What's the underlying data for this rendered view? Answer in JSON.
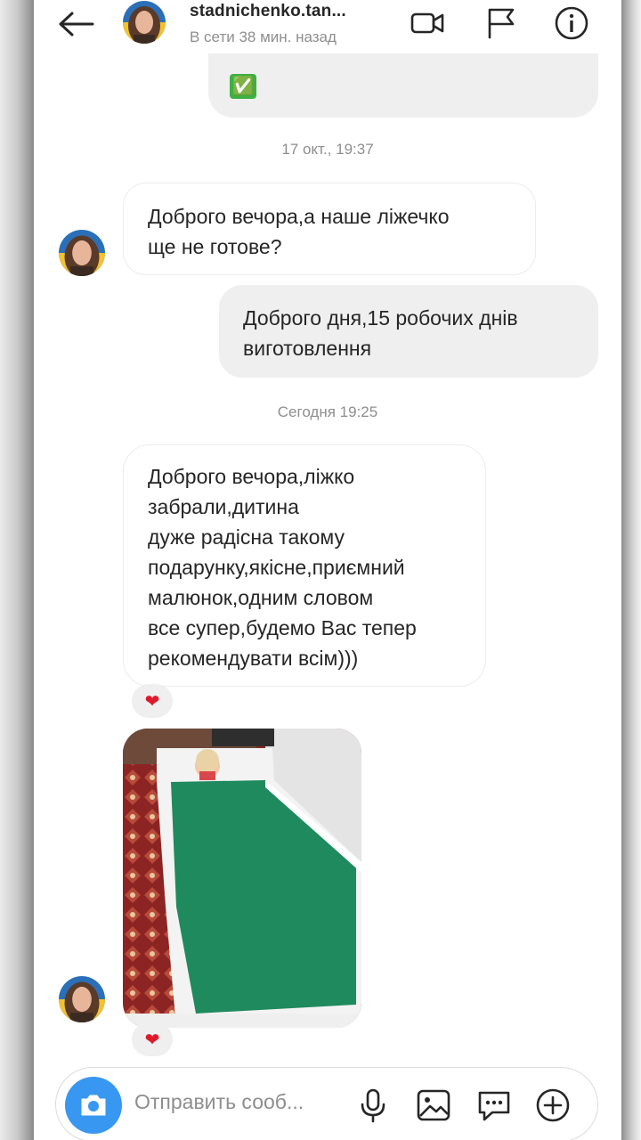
{
  "header": {
    "username": "stadnichenko.tan...",
    "status": "В сети 38 мин. назад"
  },
  "messages": {
    "top_partial_emoji": "✅",
    "timestamp1": "17 окт., 19:37",
    "msg1": [
      "Доброго вечора,а наше ліжечко",
      "ще не готове?"
    ],
    "msg2": [
      "Доброго дня,15 робочих днів",
      "виготовлення"
    ],
    "timestamp2": "Сегодня 19:25",
    "msg3": [
      "Доброго вечора,ліжко",
      "забрали,дитина",
      "дуже радісна такому",
      "подарунку,якісне,приємний",
      "малюнок,одним словом",
      "все супер,будемо Вас тепер",
      "рекомендувати всім)))"
    ],
    "reaction": "❤"
  },
  "composer": {
    "placeholder": "Отправить сооб..."
  }
}
